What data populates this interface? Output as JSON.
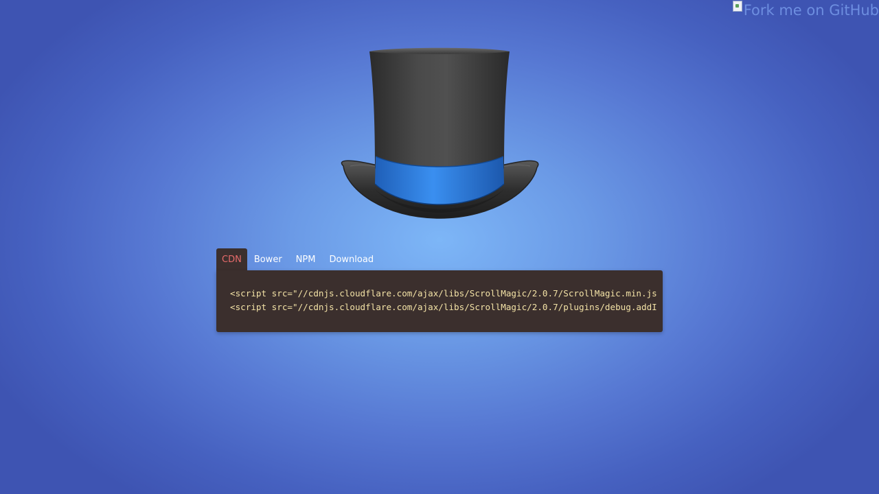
{
  "ribbon": {
    "alt_text": "Fork me on GitHub"
  },
  "logo": {
    "name": "ScrollMagic top hat"
  },
  "installer": {
    "tabs": [
      {
        "label": "CDN",
        "active": true
      },
      {
        "label": "Bower",
        "active": false
      },
      {
        "label": "NPM",
        "active": false
      },
      {
        "label": "Download",
        "active": false
      }
    ],
    "code_lines": [
      "<script src=\"//cdnjs.cloudflare.com/ajax/libs/ScrollMagic/2.0.7/ScrollMagic.min.js",
      "<script src=\"//cdnjs.cloudflare.com/ajax/libs/ScrollMagic/2.0.7/plugins/debug.addI"
    ]
  },
  "colors": {
    "background_center": "#7db6f7",
    "background_edge": "#3e54b2",
    "panel": "#3b2f2d",
    "active_tab_text": "#e86b6b",
    "code_text": "#f3e2a6",
    "hat_band": "#2f7fe0"
  }
}
